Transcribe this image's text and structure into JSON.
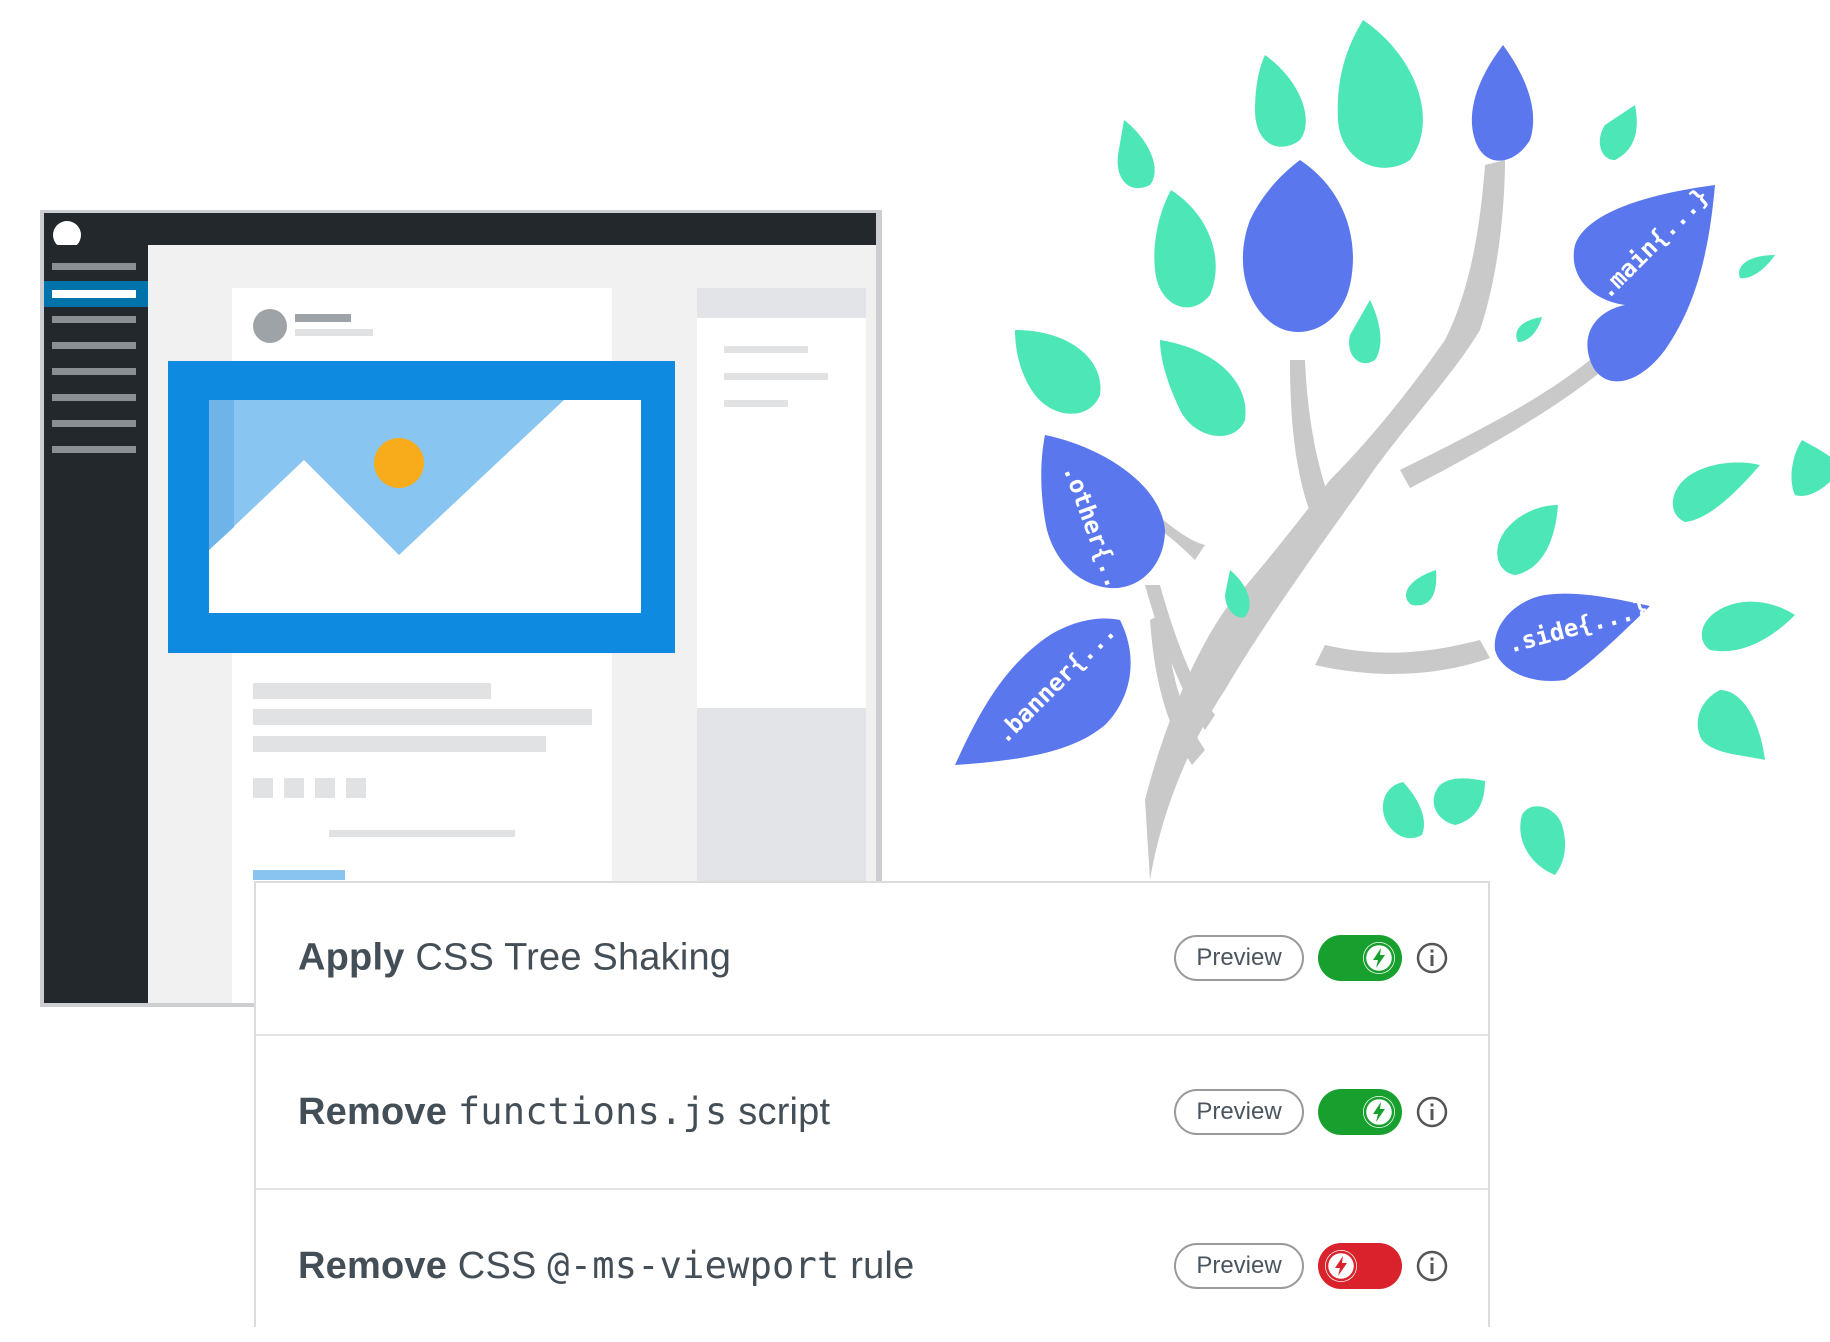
{
  "options": [
    {
      "verb": "Apply",
      "pre": " CSS Tree Shaking",
      "code": "",
      "post": "",
      "preview_label": "Preview",
      "enabled": true
    },
    {
      "verb": "Remove",
      "pre": " ",
      "code": "functions.js",
      "post": " script",
      "preview_label": "Preview",
      "enabled": true
    },
    {
      "verb": "Remove",
      "pre": " CSS ",
      "code": "@-ms-viewport",
      "post": " rule",
      "preview_label": "Preview",
      "enabled": false
    }
  ],
  "tree_labels": {
    "main": ".main{...}",
    "other": ".other{...}",
    "side": ".side{...}",
    "banner": ".banner{..."
  },
  "colors": {
    "leaf_green": "#4de6b6",
    "leaf_blue": "#5a77ee",
    "branch": "#c9c9c9",
    "toggle_on": "#18a02e",
    "toggle_off": "#d9222c",
    "hero_blue": "#0e8be1",
    "sun": "#f8ac1b"
  },
  "icons": {
    "toggle_knob": "lightning-bolt-icon",
    "info": "info-circle-icon",
    "hero": "landscape-image-icon",
    "window_logo": "circle-logo-icon"
  }
}
